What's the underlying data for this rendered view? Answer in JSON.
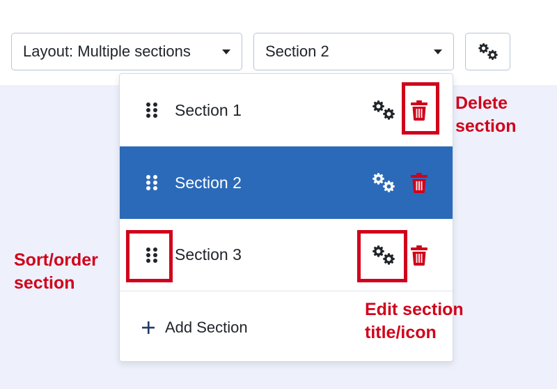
{
  "toolbar": {
    "layout_label": "Layout: Multiple sections",
    "section_select_value": "Section 2"
  },
  "sections": [
    {
      "label": "Section 1",
      "selected": false
    },
    {
      "label": "Section 2",
      "selected": true
    },
    {
      "label": "Section 3",
      "selected": false
    }
  ],
  "add_section_label": "Add Section",
  "annotations": {
    "delete": "Delete\nsection",
    "sort": "Sort/order\nsection",
    "edit": "Edit section\ntitle/icon"
  },
  "colors": {
    "selected_row": "#2b6ab9",
    "delete_icon": "#d0021b",
    "annotation": "#d0021b",
    "icon_dark": "#212529",
    "icon_light": "#ffffff"
  },
  "icons": {
    "drag": "drag-dots-icon",
    "settings": "gears-icon",
    "delete": "trash-icon",
    "add": "plus-icon",
    "dropdown": "chevron-down-icon"
  }
}
